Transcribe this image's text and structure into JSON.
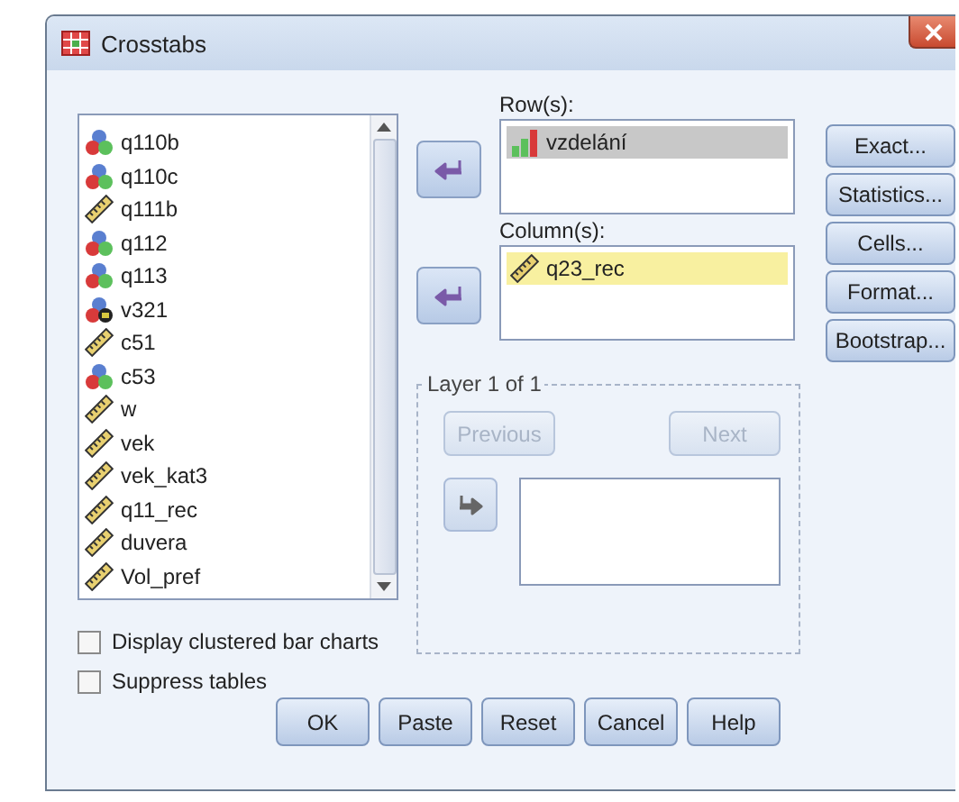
{
  "window": {
    "title": "Crosstabs"
  },
  "variables": [
    {
      "name": "q110b",
      "kind": "nominal"
    },
    {
      "name": "q110c",
      "kind": "nominal"
    },
    {
      "name": "q111b",
      "kind": "scale"
    },
    {
      "name": "q112",
      "kind": "nominal"
    },
    {
      "name": "q113",
      "kind": "nominal"
    },
    {
      "name": "v321",
      "kind": "string"
    },
    {
      "name": "c51",
      "kind": "scale"
    },
    {
      "name": "c53",
      "kind": "nominal"
    },
    {
      "name": "w",
      "kind": "scale"
    },
    {
      "name": "vek",
      "kind": "scale"
    },
    {
      "name": "vek_kat3",
      "kind": "scale"
    },
    {
      "name": "q11_rec",
      "kind": "scale"
    },
    {
      "name": "duvera",
      "kind": "scale"
    },
    {
      "name": "Vol_pref",
      "kind": "scale"
    }
  ],
  "row_box": {
    "label": "Row(s):",
    "focused": false,
    "items": [
      {
        "name": "vzdelání",
        "kind": "ordinal",
        "selected": true
      }
    ]
  },
  "column_box": {
    "label": "Column(s):",
    "focused": true,
    "items": [
      {
        "name": "q23_rec",
        "kind": "scale",
        "selected": true
      }
    ]
  },
  "layer": {
    "title": "Layer 1 of 1",
    "previous": {
      "label": "Previous",
      "disabled": true
    },
    "next": {
      "label": "Next",
      "disabled": true
    }
  },
  "side_buttons": [
    "Exact...",
    "Statistics...",
    "Cells...",
    "Format...",
    "Bootstrap..."
  ],
  "options": [
    {
      "label": "Display clustered bar charts",
      "checked": false
    },
    {
      "label": "Suppress tables",
      "checked": false
    }
  ],
  "buttons": [
    "OK",
    "Paste",
    "Reset",
    "Cancel",
    "Help"
  ]
}
